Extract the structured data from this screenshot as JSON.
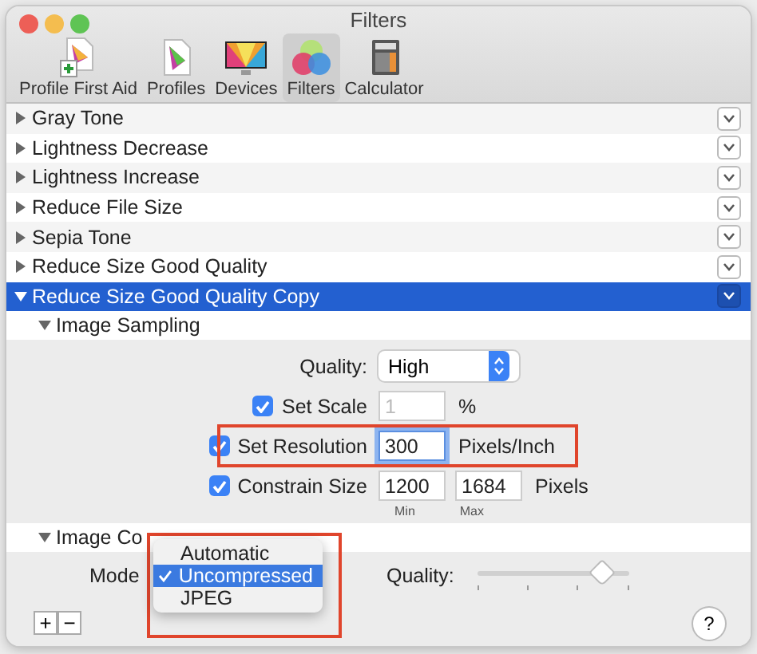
{
  "window": {
    "title": "Filters"
  },
  "toolbar": [
    {
      "label": "Profile First Aid",
      "kind": "aid",
      "selected": false
    },
    {
      "label": "Profiles",
      "kind": "profiles",
      "selected": false
    },
    {
      "label": "Devices",
      "kind": "devices",
      "selected": false
    },
    {
      "label": "Filters",
      "kind": "filters",
      "selected": true
    },
    {
      "label": "Calculator",
      "kind": "calculator",
      "selected": false
    }
  ],
  "filters": [
    {
      "name": "Gray Tone",
      "expanded": false,
      "selected": false
    },
    {
      "name": "Lightness Decrease",
      "expanded": false,
      "selected": false
    },
    {
      "name": "Lightness Increase",
      "expanded": false,
      "selected": false
    },
    {
      "name": "Reduce File Size",
      "expanded": false,
      "selected": false
    },
    {
      "name": "Sepia Tone",
      "expanded": false,
      "selected": false
    },
    {
      "name": "Reduce Size Good Quality",
      "expanded": false,
      "selected": false
    },
    {
      "name": "Reduce Size Good Quality Copy",
      "expanded": true,
      "selected": true
    }
  ],
  "image_sampling": {
    "title": "Image Sampling",
    "expanded": true,
    "quality_label": "Quality:",
    "quality_value": "High",
    "set_scale": {
      "label": "Set Scale",
      "checked": true,
      "value": "1",
      "disabled": true,
      "unit": "%"
    },
    "set_resolution": {
      "label": "Set Resolution",
      "checked": true,
      "value": "300",
      "disabled": false,
      "unit": "Pixels/Inch",
      "highlighted": true
    },
    "constrain_size": {
      "label": "Constrain Size",
      "checked": true,
      "min": "1200",
      "max": "1684",
      "min_caption": "Min",
      "max_caption": "Max",
      "unit": "Pixels"
    }
  },
  "image_compression": {
    "title": "Image Co",
    "expanded": true,
    "mode_label": "Mode",
    "quality_label": "Quality:",
    "quality": {
      "level": 0.82
    },
    "mode_menu": {
      "highlighted": true,
      "options": [
        {
          "label": "Automatic",
          "selected": false
        },
        {
          "label": "Uncompressed",
          "selected": true
        },
        {
          "label": "JPEG",
          "selected": false
        }
      ]
    }
  },
  "bottom_bar": {
    "buttons": [
      "+",
      "−"
    ],
    "help": "?"
  }
}
